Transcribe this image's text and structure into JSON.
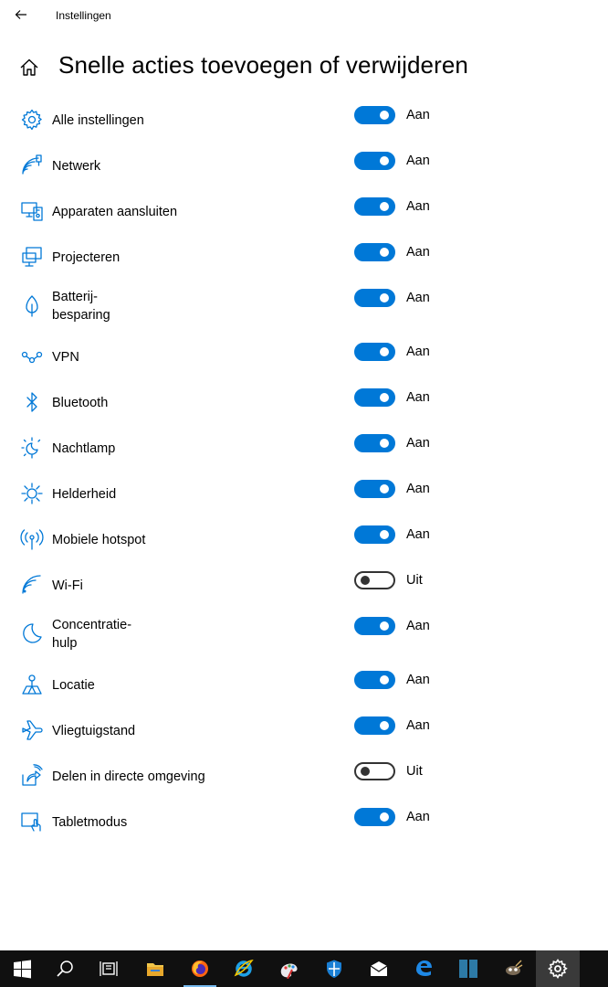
{
  "window": {
    "title": "Instellingen"
  },
  "page": {
    "title": "Snelle acties toevoegen of verwijderen"
  },
  "accent_color": "#0078d7",
  "actions": [
    {
      "icon": "gear-icon",
      "label": "Alle instellingen",
      "on": true,
      "state": "Aan"
    },
    {
      "icon": "network-icon",
      "label": "Netwerk",
      "on": true,
      "state": "Aan"
    },
    {
      "icon": "connect-devices-icon",
      "label": "Apparaten aansluiten",
      "on": true,
      "state": "Aan"
    },
    {
      "icon": "project-icon",
      "label": "Projecteren",
      "on": true,
      "state": "Aan"
    },
    {
      "icon": "battery-saver-icon",
      "label": "Batterij-\nbesparing",
      "on": true,
      "state": "Aan"
    },
    {
      "icon": "vpn-icon",
      "label": "VPN",
      "on": true,
      "state": "Aan"
    },
    {
      "icon": "bluetooth-icon",
      "label": "Bluetooth",
      "on": true,
      "state": "Aan"
    },
    {
      "icon": "night-light-icon",
      "label": "Nachtlamp",
      "on": true,
      "state": "Aan"
    },
    {
      "icon": "brightness-icon",
      "label": "Helderheid",
      "on": true,
      "state": "Aan"
    },
    {
      "icon": "mobile-hotspot-icon",
      "label": "Mobiele hotspot",
      "on": true,
      "state": "Aan"
    },
    {
      "icon": "wifi-icon",
      "label": "Wi-Fi",
      "on": false,
      "state": "Uit"
    },
    {
      "icon": "focus-assist-icon",
      "label": "Concentratie-\nhulp",
      "on": true,
      "state": "Aan"
    },
    {
      "icon": "location-icon",
      "label": "Locatie",
      "on": true,
      "state": "Aan"
    },
    {
      "icon": "airplane-icon",
      "label": "Vliegtuigstand",
      "on": true,
      "state": "Aan"
    },
    {
      "icon": "nearby-sharing-icon",
      "label": "Delen in directe omgeving",
      "on": false,
      "state": "Uit"
    },
    {
      "icon": "tablet-mode-icon",
      "label": "Tabletmodus",
      "on": true,
      "state": "Aan"
    }
  ],
  "taskbar": [
    {
      "icon": "windows-start-icon",
      "active": false
    },
    {
      "icon": "search-icon",
      "active": false
    },
    {
      "icon": "task-view-icon",
      "active": false
    },
    {
      "icon": "file-explorer-icon",
      "active": false
    },
    {
      "icon": "firefox-icon",
      "active": false,
      "running": true
    },
    {
      "icon": "internet-explorer-icon",
      "active": false
    },
    {
      "icon": "paint-icon",
      "active": false
    },
    {
      "icon": "windows-security-icon",
      "active": false
    },
    {
      "icon": "mail-icon",
      "active": false
    },
    {
      "icon": "edge-icon",
      "active": false
    },
    {
      "icon": "app-tile-icon",
      "active": false
    },
    {
      "icon": "gimp-icon",
      "active": false
    },
    {
      "icon": "settings-icon",
      "active": true
    }
  ]
}
